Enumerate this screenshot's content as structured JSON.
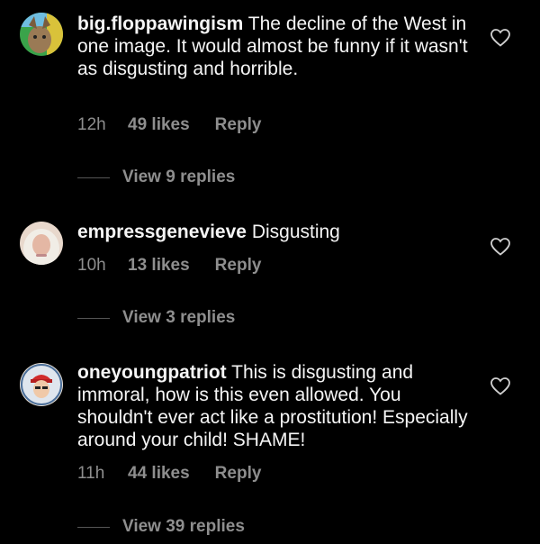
{
  "comments": [
    {
      "username": "big.floppawingism",
      "text": "The decline of the West in one image. It would almost be funny if it wasn't as disgusting and horrible.",
      "time": "12h",
      "likes": "49 likes",
      "reply": "Reply",
      "view_replies": "View 9 replies"
    },
    {
      "username": "empressgenevieve",
      "text": "Disgusting",
      "time": "10h",
      "likes": "13 likes",
      "reply": "Reply",
      "view_replies": "View 3 replies"
    },
    {
      "username": "oneyoungpatriot",
      "text": "This is disgusting and immoral, how is this even allowed. You shouldn't ever act like a prostitution! Especially around your child! SHAME!",
      "time": "11h",
      "likes": "44 likes",
      "reply": "Reply",
      "view_replies": "View 39 replies"
    }
  ],
  "icons": {
    "like": "heart-outline-icon"
  }
}
